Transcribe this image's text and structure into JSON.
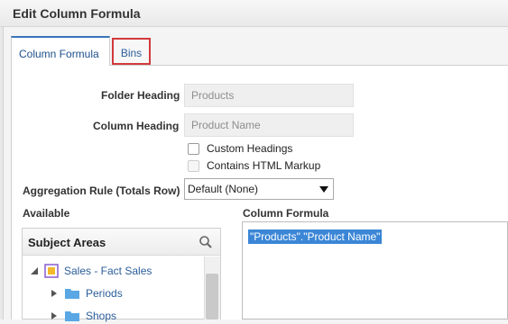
{
  "dialog": {
    "title": "Edit Column Formula"
  },
  "tabs": [
    {
      "label": "Column Formula",
      "active": true
    },
    {
      "label": "Bins",
      "active": false
    }
  ],
  "form": {
    "folder_heading_label": "Folder Heading",
    "folder_heading_value": "Products",
    "column_heading_label": "Column Heading",
    "column_heading_value": "Product Name",
    "custom_headings_label": "Custom Headings",
    "contains_html_label": "Contains HTML Markup",
    "aggregation_label": "Aggregation Rule (Totals Row)",
    "aggregation_value": "Default (None)"
  },
  "available": {
    "label": "Available",
    "subject_areas_title": "Subject Areas",
    "tree": [
      {
        "label": "Sales - Fact Sales",
        "level": 0,
        "expanded": true,
        "icon": "subject-area-icon"
      },
      {
        "label": "Periods",
        "level": 1,
        "expanded": false,
        "icon": "folder-icon"
      },
      {
        "label": "Shops",
        "level": 1,
        "expanded": false,
        "icon": "folder-icon"
      }
    ]
  },
  "formula": {
    "label": "Column Formula",
    "value": "\"Products\".\"Product Name\""
  },
  "colors": {
    "accent": "#3b74b8",
    "highlight_box": "#d23a3a",
    "selection": "#3b86d6"
  }
}
